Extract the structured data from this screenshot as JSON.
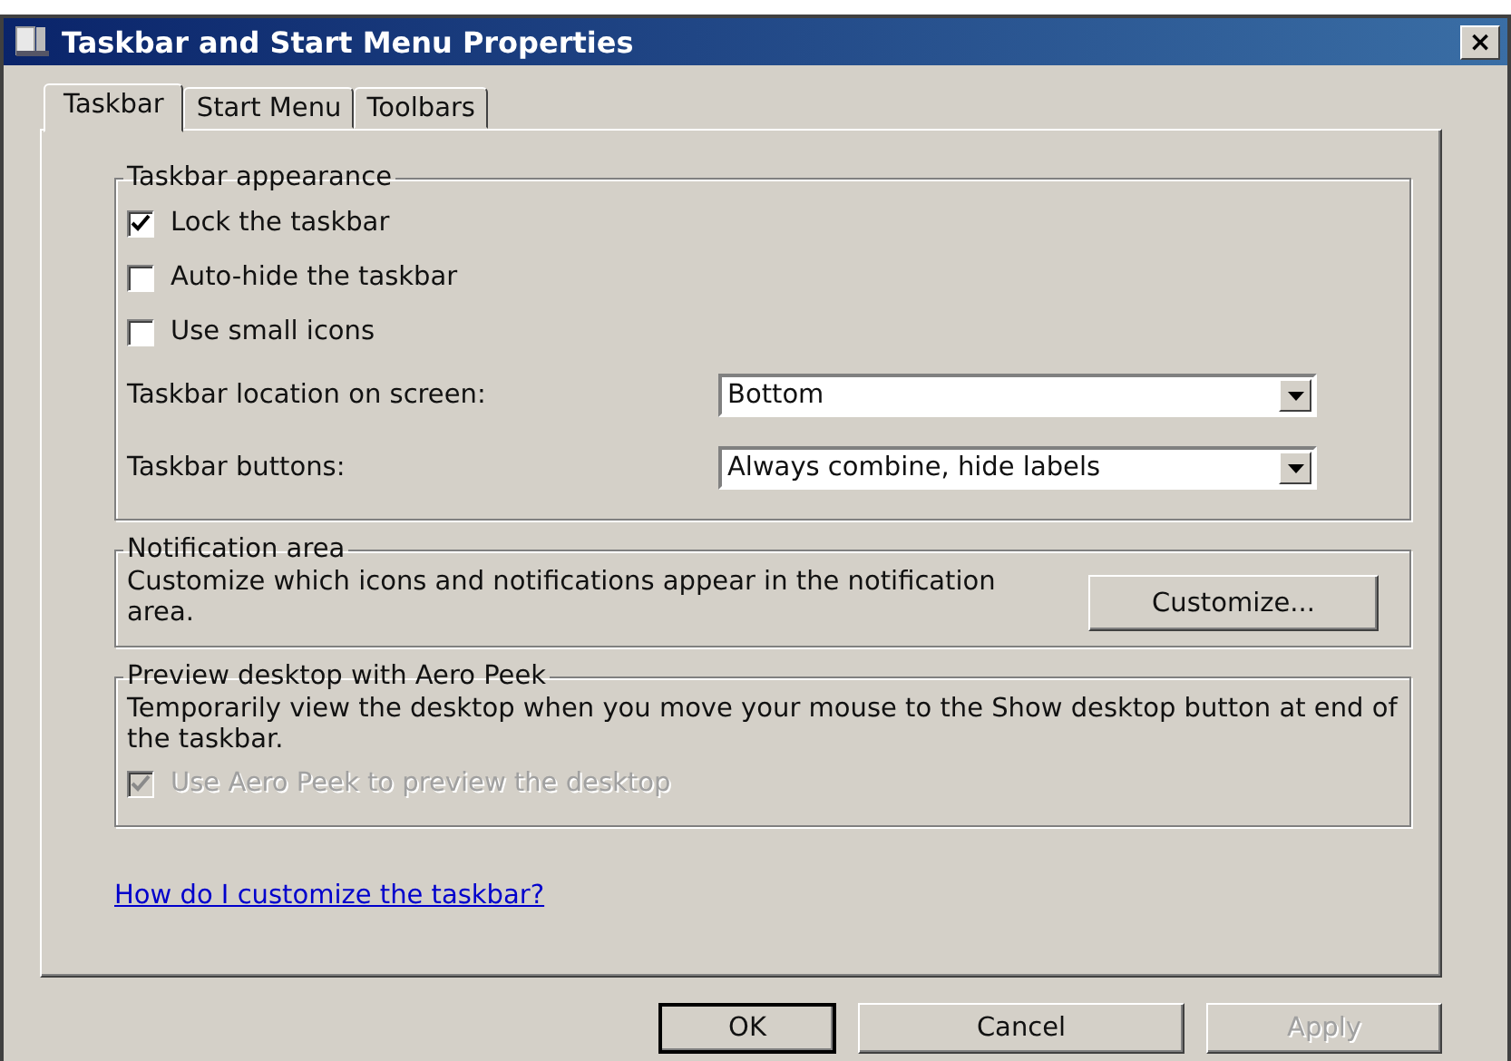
{
  "window": {
    "title": "Taskbar and Start Menu Properties",
    "close": "×"
  },
  "tabs": [
    {
      "label": "Taskbar",
      "selected": true
    },
    {
      "label": "Start Menu",
      "selected": false
    },
    {
      "label": "Toolbars",
      "selected": false
    }
  ],
  "appearance": {
    "title": "Taskbar appearance",
    "checkboxes": [
      {
        "label": "Lock the taskbar",
        "checked": true,
        "disabled": false
      },
      {
        "label": "Auto-hide the taskbar",
        "checked": false,
        "disabled": false
      },
      {
        "label": "Use small icons",
        "checked": false,
        "disabled": false
      }
    ],
    "dropdowns": [
      {
        "label": "Taskbar location on screen:",
        "value": "Bottom"
      },
      {
        "label": "Taskbar buttons:",
        "value": "Always combine, hide labels"
      }
    ]
  },
  "notification": {
    "title": "Notification area",
    "description": "Customize which icons and notifications appear in the notification area.",
    "button": "Customize..."
  },
  "peek": {
    "title": "Preview desktop with Aero Peek",
    "description": "Temporarily view the desktop when you move your mouse to the Show desktop button at end of the taskbar.",
    "checkbox": {
      "label": "Use Aero Peek to preview the desktop",
      "checked": true,
      "disabled": true
    }
  },
  "link": "How do I customize the taskbar?",
  "buttons": [
    {
      "label": "OK",
      "default": true,
      "disabled": false
    },
    {
      "label": "Cancel",
      "default": false,
      "disabled": false
    },
    {
      "label": "Apply",
      "default": false,
      "disabled": true
    }
  ]
}
